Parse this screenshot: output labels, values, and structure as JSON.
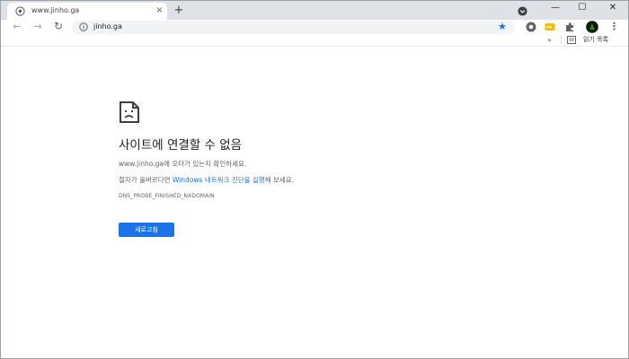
{
  "tab": {
    "title": "www.jinho.ga",
    "close_glyph": "×",
    "favicon": "globe-icon"
  },
  "new_tab_glyph": "+",
  "window_controls": {
    "minimize": "—",
    "maximize": "☐",
    "close": "✕"
  },
  "toolbar": {
    "back_glyph": "←",
    "forward_glyph": "→",
    "reload_glyph": "↻",
    "url": "jinho.ga",
    "star_glyph": "★",
    "menu_glyph": "⋮"
  },
  "bookmarks": {
    "overflow_glyph": "»",
    "reading_list_label": "읽기 목록"
  },
  "error_page": {
    "title": "사이트에 연결할 수 없음",
    "line1": "www.jinho.ga에 오타가 있는지 확인하세요.",
    "line2_prefix": "철자가 올바르다면 ",
    "line2_link": "Windows 네트워크 진단을 실행",
    "line2_suffix": "해 보세요.",
    "error_code": "DNS_PROBE_FINISHED_NXDOMAIN",
    "reload_button": "새로고침"
  },
  "colors": {
    "accent": "#1a73e8",
    "tabstrip": "#dee1e6",
    "omnibox": "#f1f3f4"
  }
}
